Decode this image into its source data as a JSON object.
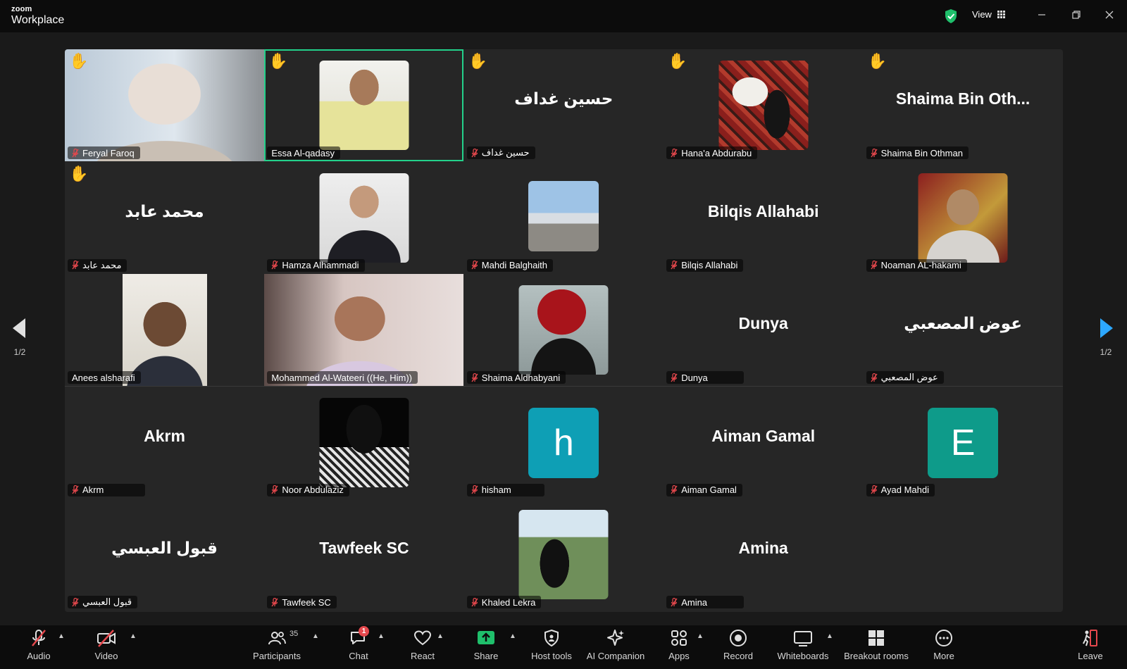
{
  "app": {
    "brand_top": "zoom",
    "brand_bottom": "Workplace",
    "view_label": "View"
  },
  "pager": {
    "left_page": "1/2",
    "right_page": "1/2"
  },
  "colors": {
    "active_border": "#23d18b",
    "hand": "#f6c33a",
    "letter_h": "#0e9fb5",
    "letter_e": "#0e9b8a",
    "share": "#1fbf6b",
    "chat_badge": "#e5484d",
    "next_arrow": "#2da8ff"
  },
  "participants": [
    {
      "label": "Feryal Faroq",
      "display": "",
      "hand": true,
      "muted": true,
      "media": "photo-full"
    },
    {
      "label": "Essa Al-qadasy",
      "display": "",
      "hand": true,
      "muted": false,
      "media": "photo",
      "active": true
    },
    {
      "label": "حسين غداف",
      "display": "حسين غداف",
      "hand": true,
      "muted": true,
      "media": "name"
    },
    {
      "label": "Hana'a Abdurabu",
      "display": "",
      "hand": true,
      "muted": true,
      "media": "photo"
    },
    {
      "label": "Shaima Bin Othman",
      "display": "Shaima Bin Oth...",
      "hand": true,
      "muted": true,
      "media": "name"
    },
    {
      "label": "محمد عابد",
      "display": "محمد عابد",
      "hand": true,
      "muted": true,
      "media": "name"
    },
    {
      "label": "Hamza Alhammadi",
      "display": "",
      "hand": false,
      "muted": true,
      "media": "photo"
    },
    {
      "label": "Mahdi Balghaith",
      "display": "",
      "hand": false,
      "muted": true,
      "media": "photo-small"
    },
    {
      "label": "Bilqis Allahabi",
      "display": "Bilqis Allahabi",
      "hand": false,
      "muted": true,
      "media": "name"
    },
    {
      "label": "Noaman AL-hakami",
      "display": "",
      "hand": false,
      "muted": true,
      "media": "photo"
    },
    {
      "label": "Anees alsharafi",
      "display": "",
      "hand": false,
      "muted": false,
      "media": "photo-tall"
    },
    {
      "label": "Mohammed Al-Wateeri ((He, Him))",
      "display": "",
      "hand": false,
      "muted": false,
      "media": "photo-full"
    },
    {
      "label": "Shaima Aldhabyani",
      "display": "",
      "hand": false,
      "muted": true,
      "media": "photo"
    },
    {
      "label": "Dunya",
      "display": "Dunya",
      "hand": false,
      "muted": true,
      "media": "name"
    },
    {
      "label": "عوض المصعبي",
      "display": "عوض المصعبي",
      "hand": false,
      "muted": true,
      "media": "name"
    },
    {
      "label": "Akrm",
      "display": "Akrm",
      "hand": false,
      "muted": true,
      "media": "name"
    },
    {
      "label": "Noor Abdulaziz",
      "display": "",
      "hand": false,
      "muted": true,
      "media": "photo"
    },
    {
      "label": "hisham",
      "display": "h",
      "hand": false,
      "muted": true,
      "media": "letter"
    },
    {
      "label": "Aiman Gamal",
      "display": "Aiman Gamal",
      "hand": false,
      "muted": true,
      "media": "name"
    },
    {
      "label": "Ayad Mahdi",
      "display": "E",
      "hand": false,
      "muted": true,
      "media": "letter"
    },
    {
      "label": "قبول العبسي",
      "display": "قبول العبسي",
      "hand": false,
      "muted": true,
      "media": "name"
    },
    {
      "label": "Tawfeek SC",
      "display": "Tawfeek SC",
      "hand": false,
      "muted": true,
      "media": "name"
    },
    {
      "label": "Khaled Lekra",
      "display": "",
      "hand": false,
      "muted": true,
      "media": "photo"
    },
    {
      "label": "Amina",
      "display": "Amina",
      "hand": false,
      "muted": true,
      "media": "name"
    }
  ],
  "toolbar": {
    "audio": "Audio",
    "video": "Video",
    "participants": "Participants",
    "participants_count": "35",
    "chat": "Chat",
    "chat_badge": "1",
    "react": "React",
    "share": "Share",
    "host_tools": "Host tools",
    "ai_companion": "AI Companion",
    "apps": "Apps",
    "record": "Record",
    "whiteboards": "Whiteboards",
    "breakout_rooms": "Breakout rooms",
    "more": "More",
    "leave": "Leave"
  }
}
